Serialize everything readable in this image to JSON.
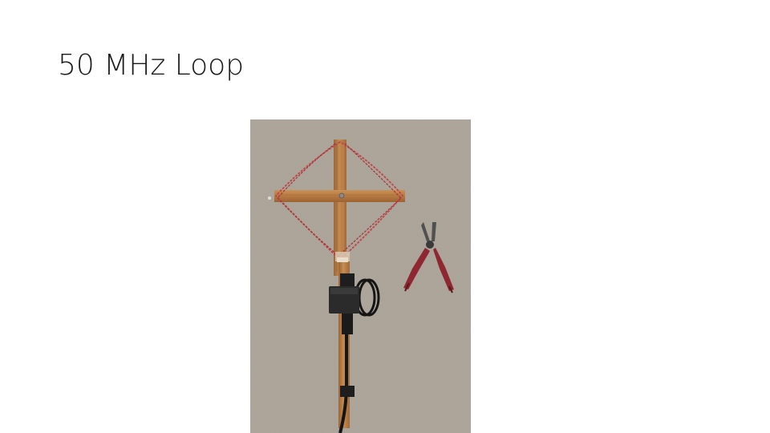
{
  "slide": {
    "title": "50 MHz Loop"
  },
  "photo": {
    "subject": "wooden-cross-loop-antenna-with-pliers",
    "colors": {
      "concrete": "#a9a195",
      "wood": "#b77c45",
      "wire": "#c0434a",
      "box": "#2a2a2a",
      "plier_handle": "#8e2730"
    }
  }
}
